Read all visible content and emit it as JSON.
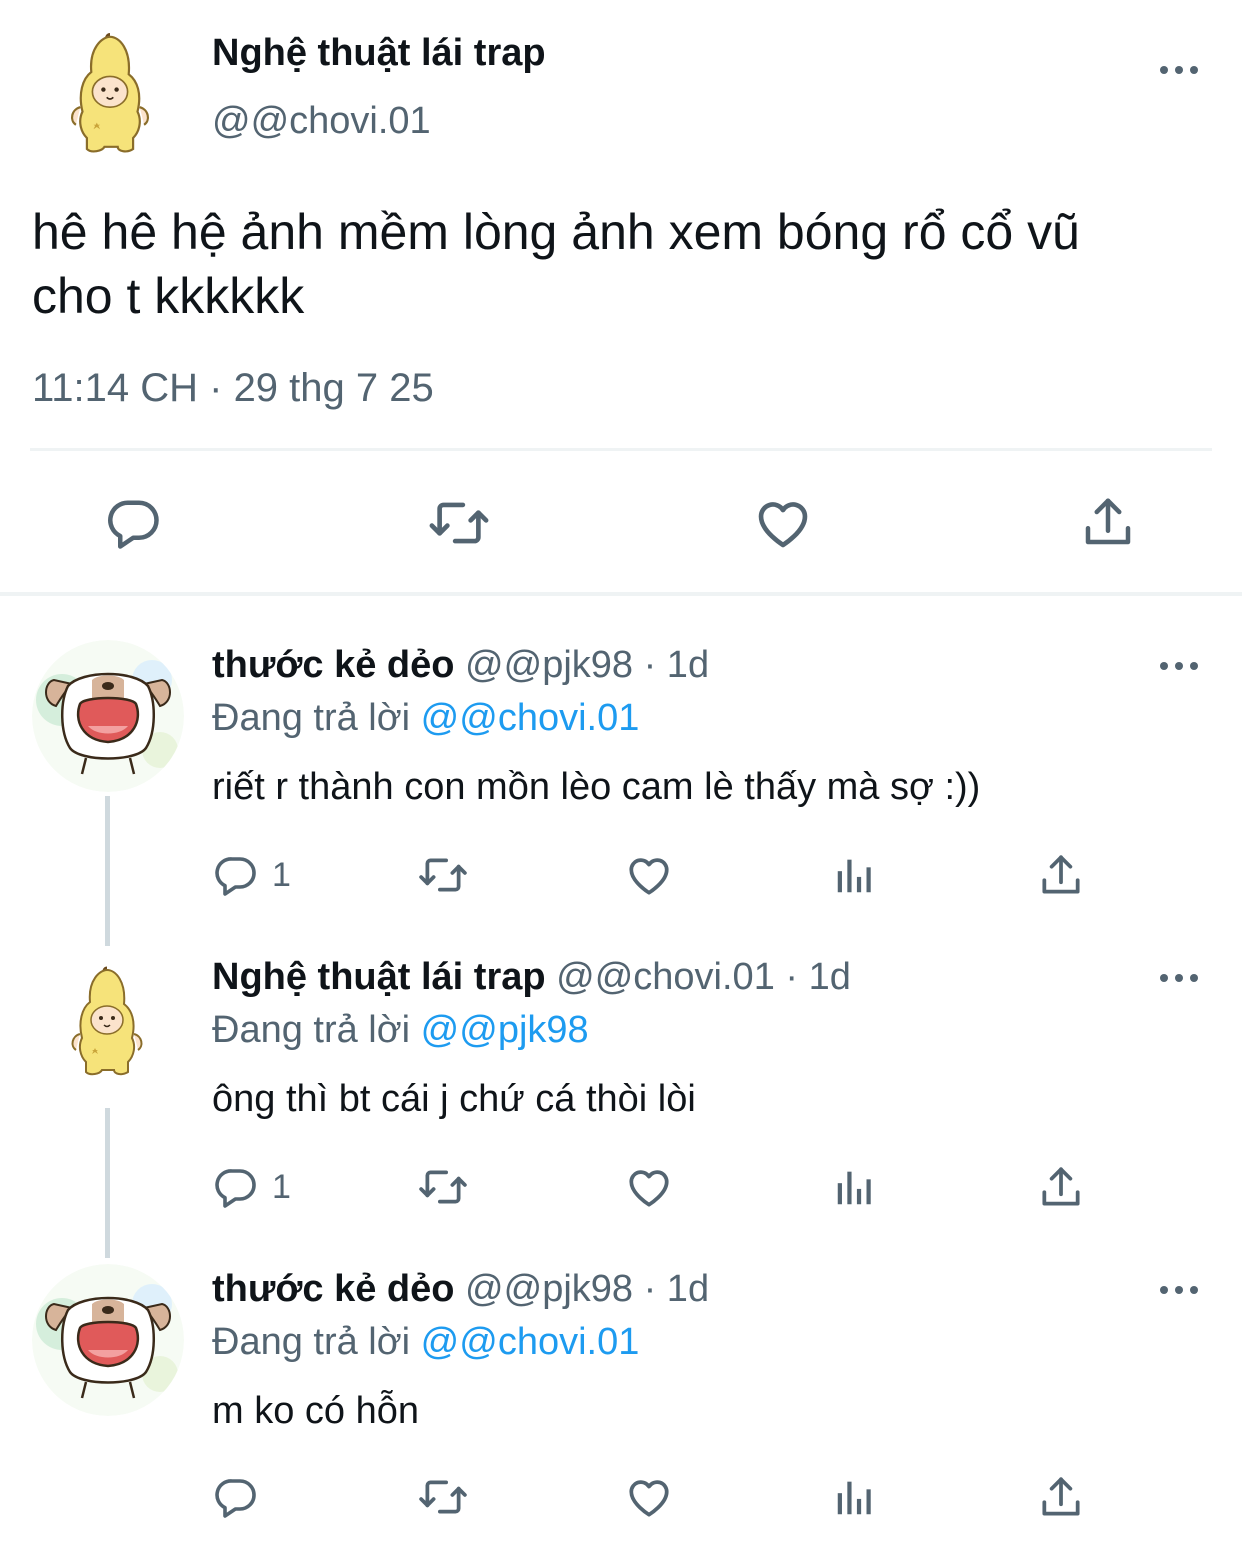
{
  "main_tweet": {
    "display_name": "Nghệ thuật lái trap",
    "handle": "@@chovi.01",
    "text_line1": "hê hê hệ ảnh mềm lòng ảnh xem bóng rổ cổ vũ",
    "text_line2": "cho t kkkkkk",
    "timestamp": "11:14 CH · 29 thg 7 25",
    "actions": [
      "reply-icon",
      "retweet-icon",
      "like-icon",
      "share-icon"
    ]
  },
  "replies": [
    {
      "display_name": "thước kẻ dẻo",
      "meta": "@@pjk98 · 1d",
      "replying_prefix": "Đang trả lời",
      "replying_to": "@@chovi.01",
      "text": "riết r thành con mồn lèo cam lè thấy mà sợ :))",
      "reply_count": "1"
    },
    {
      "display_name": "Nghệ thuật lái trap",
      "meta": "@@chovi.01 · 1d",
      "replying_prefix": "Đang trả lời",
      "replying_to": "@@pjk98",
      "text": "ông thì bt cái j chứ cá thòi lòi",
      "reply_count": "1"
    },
    {
      "display_name": "thước kẻ dẻo",
      "meta": "@@pjk98 · 1d",
      "replying_prefix": "Đang trả lời",
      "replying_to": "@@chovi.01",
      "text": "m ko có hỗn",
      "reply_count": ""
    }
  ],
  "colors": {
    "text": "#0f1419",
    "secondary": "#536471",
    "link": "#1d9bf0",
    "divider": "#eff3f4"
  }
}
